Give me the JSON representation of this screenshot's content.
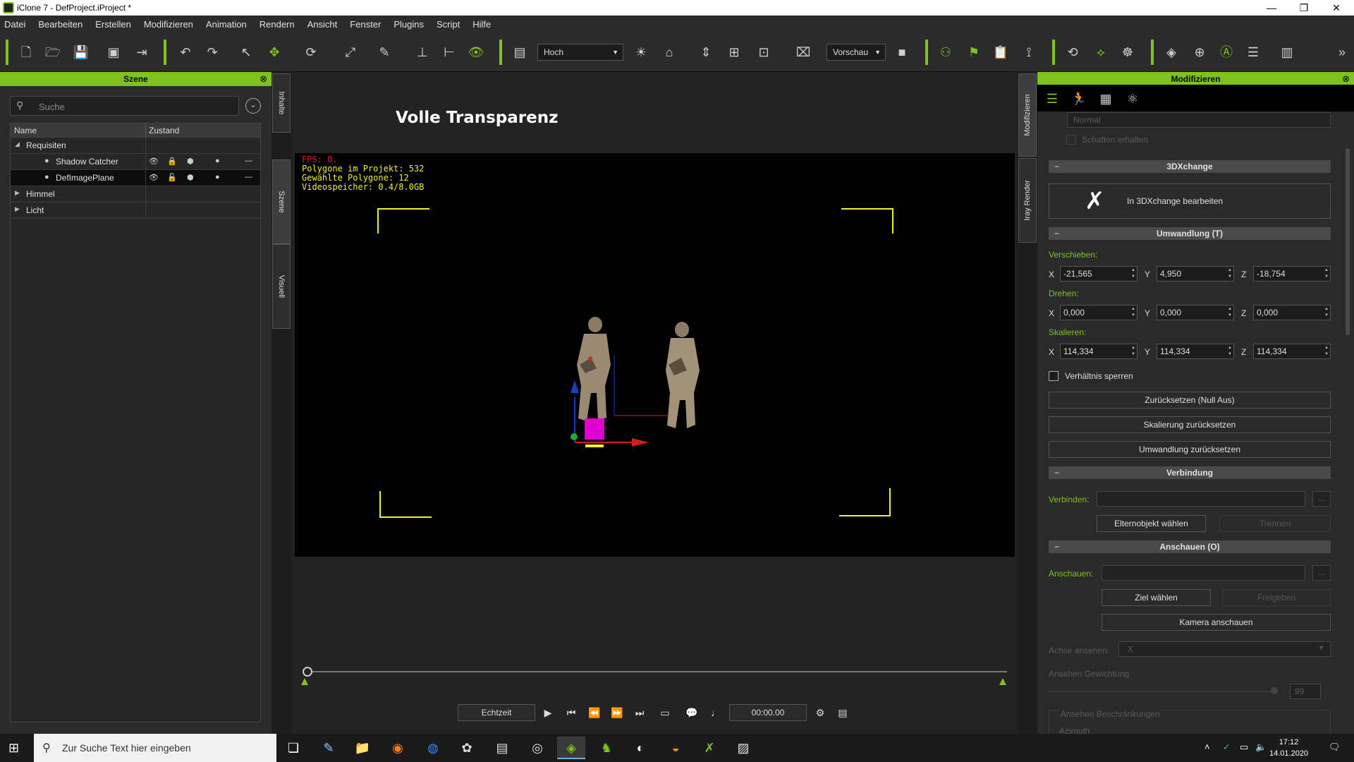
{
  "window": {
    "title": "iClone 7 - DefProject.iProject *",
    "minimize": "—",
    "maximize": "❐",
    "close": "✕"
  },
  "menu": [
    "Datei",
    "Bearbeiten",
    "Erstellen",
    "Modifizieren",
    "Animation",
    "Rendern",
    "Ansicht",
    "Fenster",
    "Plugins",
    "Script",
    "Hilfe"
  ],
  "toolbar": {
    "quality_select": "Hoch",
    "preview_select": "Vorschau"
  },
  "left_panel": {
    "title": "Szene",
    "search_placeholder": "Suche",
    "columns": [
      "Name",
      "Zustand"
    ],
    "tree": [
      {
        "label": "Requisiten",
        "level": 0,
        "expanded": true
      },
      {
        "label": "Shadow Catcher",
        "level": 1
      },
      {
        "label": "DefImagePlane",
        "level": 1,
        "selected": true
      },
      {
        "label": "Himmel",
        "level": 0,
        "expanded": false
      },
      {
        "label": "Licht",
        "level": 0,
        "expanded": false
      }
    ]
  },
  "side_tabs": [
    "Inhalte",
    "Szene",
    "Visuell"
  ],
  "right_side_tabs": [
    "Modifizieren",
    "Iray Render"
  ],
  "viewport": {
    "heading": "Volle Transparenz",
    "fps": "FPS: 0.",
    "polygons_project": "Polygone im Projekt: 532",
    "polygons_selected": "Gewählte Polygone: 12",
    "video_memory": "Videospeicher: 0.4/8.0GB"
  },
  "playback": {
    "mode": "Echtzeit",
    "time": "00:00.00"
  },
  "right_panel": {
    "title": "Modifizieren",
    "dim_normal": "Normal",
    "dim_keep_shadow": "Schatten erhalten",
    "sec_3dx": "3DXchange",
    "btn_3dx": "In 3DXchange bearbeiten",
    "sec_transform": "Umwandlung (T)",
    "move_label": "Verschieben:",
    "rotate_label": "Drehen:",
    "scale_label": "Skalieren:",
    "move": {
      "x": "-21,565",
      "y": "4,950",
      "z": "-18,754"
    },
    "rotate": {
      "x": "0,000",
      "y": "0,000",
      "z": "0,000"
    },
    "scale": {
      "x": "114,334",
      "y": "114,334",
      "z": "114,334"
    },
    "lock_ratio": "Verhältnis sperren",
    "btn_reset_null": "Zurücksetzen (Null Aus)",
    "btn_reset_scale": "Skalierung zurücksetzen",
    "btn_reset_transform": "Umwandlung zurücksetzen",
    "sec_link": "Verbindung",
    "link_label": "Verbinden:",
    "btn_pick_parent": "Elternobjekt wählen",
    "btn_detach": "Trennen",
    "sec_lookat": "Anschauen (O)",
    "lookat_label": "Anschauen:",
    "btn_pick_target": "Ziel wählen",
    "btn_release": "Freigeben",
    "btn_look_camera": "Kamera anschauen",
    "axis_label": "Achse ansehen:",
    "axis_value": "X",
    "weight_label": "Ansehen Gewichtung",
    "weight_value": "99",
    "constraints_label": "Ansehen Beschränkungen",
    "azimuth_label": "Azimuth"
  },
  "taskbar": {
    "search_placeholder": "Zur Suche Text hier eingeben",
    "time": "17:12",
    "date": "14.01.2020"
  },
  "colors": {
    "accent": "#7ec21e",
    "gizmo_magenta": "#e000d0",
    "overlay_yellow": "#f0ef2e"
  }
}
